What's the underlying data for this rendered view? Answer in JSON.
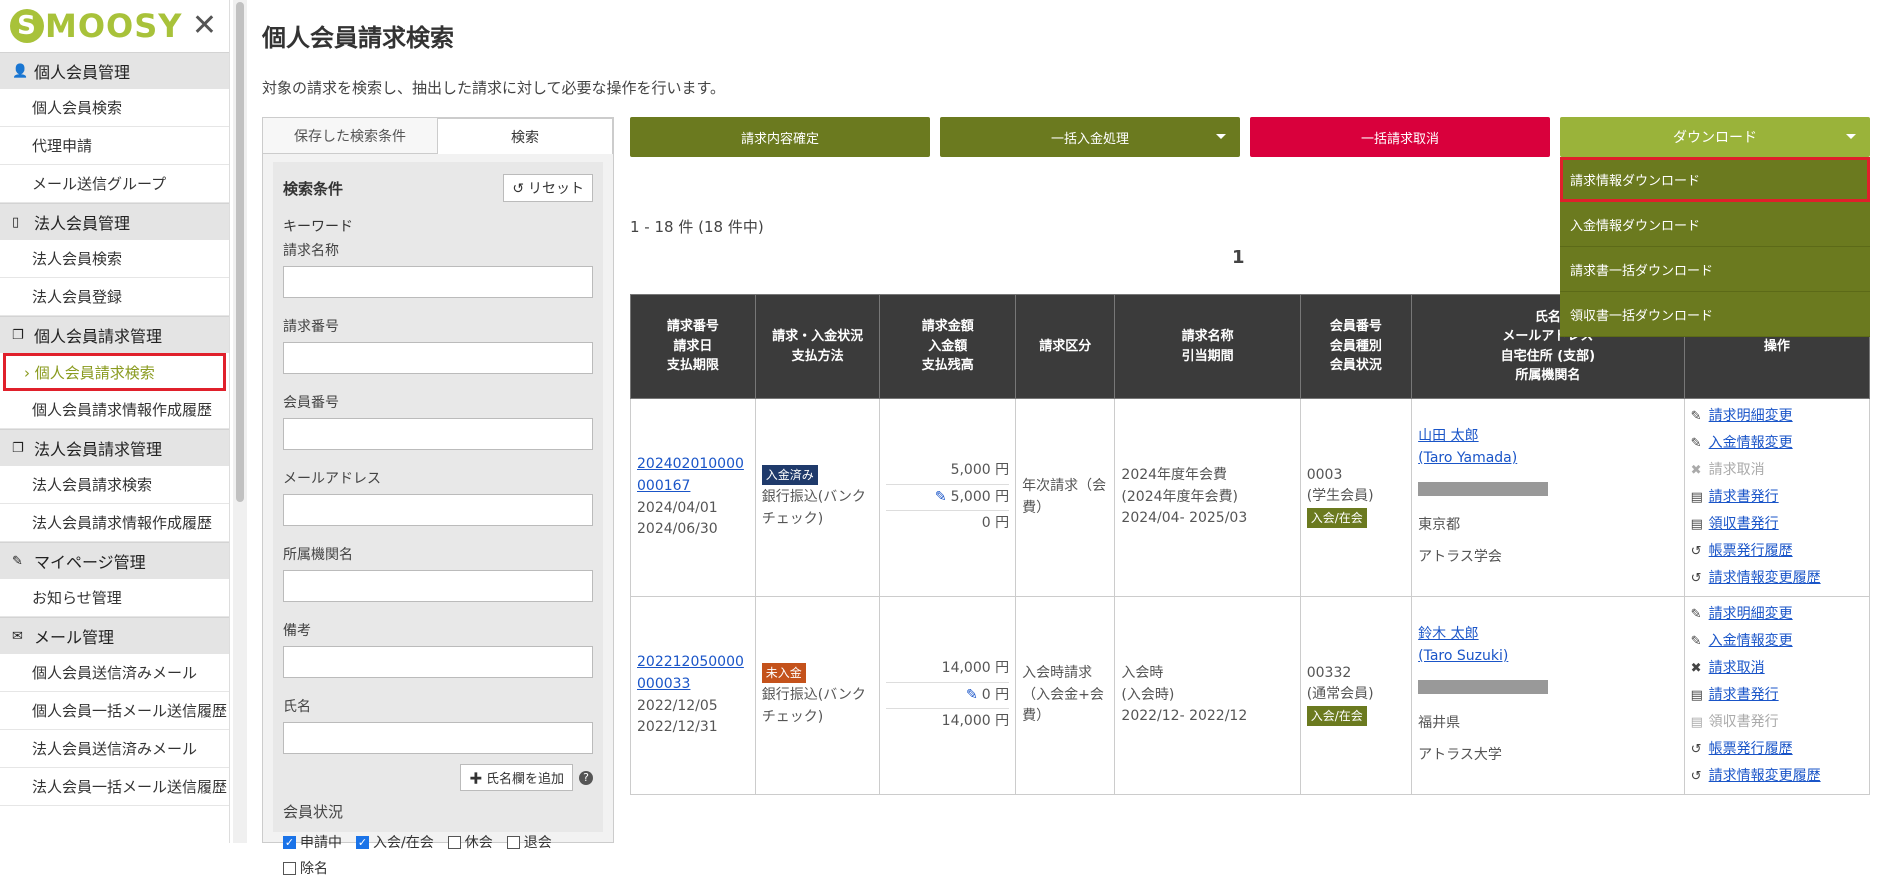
{
  "logo": "SMOOSY",
  "sidebar": {
    "sections": [
      {
        "title": "個人会員管理",
        "icon": "person-icon",
        "items": [
          "個人会員検索",
          "代理申請",
          "メール送信グループ"
        ]
      },
      {
        "title": "法人会員管理",
        "icon": "building-icon",
        "items": [
          "法人会員検索",
          "法人会員登録"
        ]
      },
      {
        "title": "個人会員請求管理",
        "icon": "document-icon",
        "items": [
          "個人会員請求検索",
          "個人会員請求情報作成履歴"
        ]
      },
      {
        "title": "法人会員請求管理",
        "icon": "document-icon",
        "items": [
          "法人会員請求検索",
          "法人会員請求情報作成履歴"
        ]
      },
      {
        "title": "マイページ管理",
        "icon": "pen-icon",
        "items": [
          "お知らせ管理"
        ]
      },
      {
        "title": "メール管理",
        "icon": "mail-icon",
        "items": [
          "個人会員送信済みメール",
          "個人会員一括メール送信履歴",
          "法人会員送信済みメール",
          "法人会員一括メール送信履歴"
        ]
      }
    ],
    "active_item": "個人会員請求検索",
    "active_prefix": "›"
  },
  "page": {
    "title": "個人会員請求検索",
    "description": "対象の請求を検索し、抽出した請求に対して必要な操作を行います。"
  },
  "search": {
    "tabs": [
      "保存した検索条件",
      "検索"
    ],
    "active_tab": "検索",
    "cond_title": "検索条件",
    "reset_label": "リセット",
    "keyword_label": "キーワード",
    "fields": [
      "請求名称",
      "請求番号",
      "会員番号",
      "メールアドレス",
      "所属機関名",
      "備考",
      "氏名"
    ],
    "add_name_label": "氏名欄を追加",
    "status_title": "会員状況",
    "statuses": [
      {
        "label": "申請中",
        "checked": true
      },
      {
        "label": "入会/在会",
        "checked": true
      },
      {
        "label": "休会",
        "checked": false
      },
      {
        "label": "退会",
        "checked": false
      },
      {
        "label": "除名",
        "checked": false
      }
    ]
  },
  "actions": {
    "confirm": "請求内容確定",
    "bulk_payment": "一括入金処理",
    "bulk_cancel": "一括請求取消",
    "download": "ダウンロード"
  },
  "download_menu": [
    "請求情報ダウンロード",
    "入金情報ダウンロード",
    "請求書一括ダウンロード",
    "領収書一括ダウンロード"
  ],
  "download_menu_highlight": "請求情報ダウンロード",
  "results": {
    "count": "1 - 18 件 (18 件中)",
    "page": "1"
  },
  "table": {
    "headers": [
      "請求番号\n請求日\n支払期限",
      "請求・入金状況\n支払方法",
      "請求金額\n入金額\n支払残高",
      "請求区分",
      "請求名称\n引当期間",
      "会員番号\n会員種別\n会員状況",
      "氏名\nメールアドレス\n自宅住所 (支部)\n所属機関名",
      "操作"
    ],
    "rows": [
      {
        "invoice_no_1": "202402010000",
        "invoice_no_2": "000167",
        "invoice_date": "2024/04/01",
        "due_date": "2024/06/30",
        "status_badge": "入金済み",
        "status_type": "paid",
        "method": "銀行振込(バンクチェック)",
        "amount": "5,000 円",
        "paid": "5,000 円",
        "balance": "0 円",
        "category": "年次請求（会費）",
        "name_title": "2024年度年会費",
        "name_sub": "(2024年度年会費)",
        "period": "2024/04- 2025/03",
        "member_no": "0003",
        "member_type": "(学生会員)",
        "member_status": "入会/在会",
        "person": "山田 太郎",
        "person_en": "(Taro Yamada)",
        "address": "東京都",
        "org": "アトラス学会",
        "ops": [
          {
            "label": "請求明細変更",
            "icon": "pencil-icon",
            "enabled": true
          },
          {
            "label": "入金情報変更",
            "icon": "pencil-icon",
            "enabled": true
          },
          {
            "label": "請求取消",
            "icon": "x-icon",
            "enabled": false
          },
          {
            "label": "請求書発行",
            "icon": "file-icon",
            "enabled": true
          },
          {
            "label": "領収書発行",
            "icon": "file-icon",
            "enabled": true
          },
          {
            "label": "帳票発行履歴",
            "icon": "history-icon",
            "enabled": true
          },
          {
            "label": "請求情報変更履歴",
            "icon": "history-icon",
            "enabled": true
          }
        ]
      },
      {
        "invoice_no_1": "202212050000",
        "invoice_no_2": "000033",
        "invoice_date": "2022/12/05",
        "due_date": "2022/12/31",
        "status_badge": "未入金",
        "status_type": "unpaid",
        "method": "銀行振込(バンクチェック)",
        "amount": "14,000 円",
        "paid": "0 円",
        "balance": "14,000 円",
        "category": "入会時請求（入会金+会費）",
        "name_title": "入会時",
        "name_sub": "(入会時)",
        "period": "2022/12- 2022/12",
        "member_no": "00332",
        "member_type": "(通常会員)",
        "member_status": "入会/在会",
        "person": "鈴木 太郎",
        "person_en": "(Taro Suzuki)",
        "address": "福井県",
        "org": "アトラス大学",
        "ops": [
          {
            "label": "請求明細変更",
            "icon": "pencil-icon",
            "enabled": true
          },
          {
            "label": "入金情報変更",
            "icon": "pencil-icon",
            "enabled": true
          },
          {
            "label": "請求取消",
            "icon": "x-icon",
            "enabled": true
          },
          {
            "label": "請求書発行",
            "icon": "file-icon",
            "enabled": true
          },
          {
            "label": "領収書発行",
            "icon": "file-icon",
            "enabled": false
          },
          {
            "label": "帳票発行履歴",
            "icon": "history-icon",
            "enabled": true
          },
          {
            "label": "請求情報変更履歴",
            "icon": "history-icon",
            "enabled": true
          }
        ]
      }
    ]
  },
  "colors": {
    "brand": "#a8c23a",
    "olive_button": "#6b7a1f",
    "danger_button": "#d9003c",
    "highlight_border": "#e0202b"
  }
}
